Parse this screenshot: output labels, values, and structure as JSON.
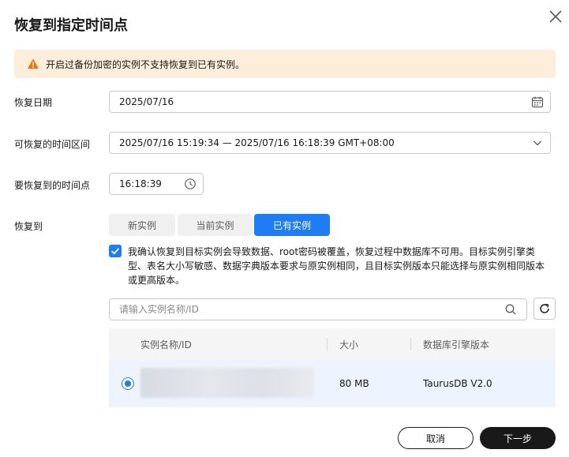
{
  "dialog": {
    "title": "恢复到指定时间点"
  },
  "alert": {
    "text": "开启过备份加密的实例不支持恢复到已有实例。",
    "color": "#fdeedb",
    "icon": "warning-icon"
  },
  "form": {
    "restore_date": {
      "label": "恢复日期",
      "value": "2025/07/16",
      "icon": "calendar-icon"
    },
    "time_range": {
      "label": "可恢复的时间区间",
      "value": "2025/07/16 15:19:34 — 2025/07/16 16:18:39 GMT+08:00",
      "icon": "chevron-down-icon"
    },
    "restore_time": {
      "label": "要恢复到的时间点",
      "value": "16:18:39",
      "icon": "clock-icon"
    },
    "restore_to": {
      "label": "恢复到",
      "options": [
        "新实例",
        "当前实例",
        "已有实例"
      ],
      "selected": "已有实例"
    }
  },
  "confirm": {
    "checked": true,
    "text": "我确认恢复到目标实例会导致数据、root密码被覆盖，恢复过程中数据库不可用。目标实例引擎类型、表名大小写敏感、数据字典版本要求与原实例相同，且目标实例版本只能选择与原实例相同版本或更高版本。"
  },
  "search": {
    "placeholder": "请输入实例名称/ID",
    "icon": "search-icon"
  },
  "table": {
    "columns": [
      "实例名称/ID",
      "大小",
      "数据库引擎版本"
    ],
    "rows": [
      {
        "selected": true,
        "size": "80 MB",
        "engine": "TaurusDB V2.0"
      }
    ]
  },
  "footer": {
    "cancel": "取消",
    "next": "下一步"
  },
  "colors": {
    "primary": "#1f7cf7",
    "dark": "#191919"
  }
}
